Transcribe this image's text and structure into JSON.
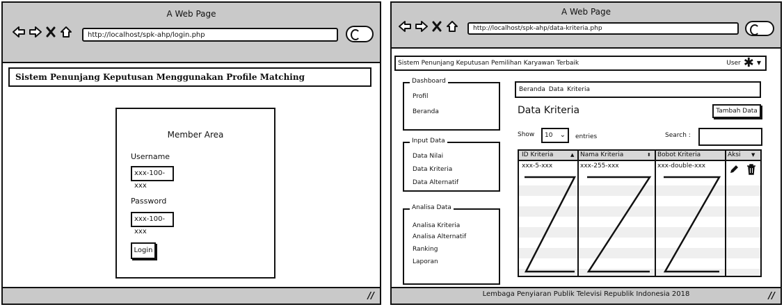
{
  "login_window": {
    "title": "A Web Page",
    "url": "http://localhost/spk-ahp/login.php",
    "app_title": "Sistem Penunjang Keputusan Menggunakan Profile Matching",
    "member_area": "Member Area",
    "username_label": "Username",
    "username_value": "xxx-100-xxx",
    "password_label": "Password",
    "password_value": "xxx-100-xxx",
    "login_button": "Login",
    "resize_grip": "//"
  },
  "kriteria_window": {
    "title": "A Web Page",
    "url": "http://localhost/spk-ahp/data-kriteria.php",
    "app_title": "Sistem Penunjang Keputusan Pemilihan Karyawan Terbaik",
    "user_menu": "User",
    "sidebar": {
      "dashboard": {
        "legend": "Dashboard",
        "items": [
          "Profil",
          "Beranda"
        ]
      },
      "input": {
        "legend": "Input Data",
        "items": [
          "Data Nilai",
          "Data Kriteria",
          "Data Alternatif"
        ]
      },
      "analisa": {
        "legend": "Analisa Data",
        "items": [
          "Analisa Kriteria",
          "Analisa Alternatif",
          "Ranking",
          "Laporan"
        ]
      }
    },
    "breadcrumb": "Beranda Data Kriteria",
    "page_title": "Data Kriteria",
    "add_button": "Tambah Data",
    "show_label": "Show",
    "entries_value": "10",
    "entries_label": "entries",
    "search_label": "Search :",
    "search_value": "",
    "table": {
      "headers": [
        "ID Kriteria",
        "Nama Kriteria",
        "Bobot Kriteria",
        "Aksi"
      ],
      "row": [
        "xxx-5-xxx",
        "xxx-255-xxx",
        "xxx-double-xxx"
      ]
    },
    "footer": "Lembaga Penyiaran Publik Televisi Republik Indonesia 2018",
    "resize_grip": "//"
  }
}
